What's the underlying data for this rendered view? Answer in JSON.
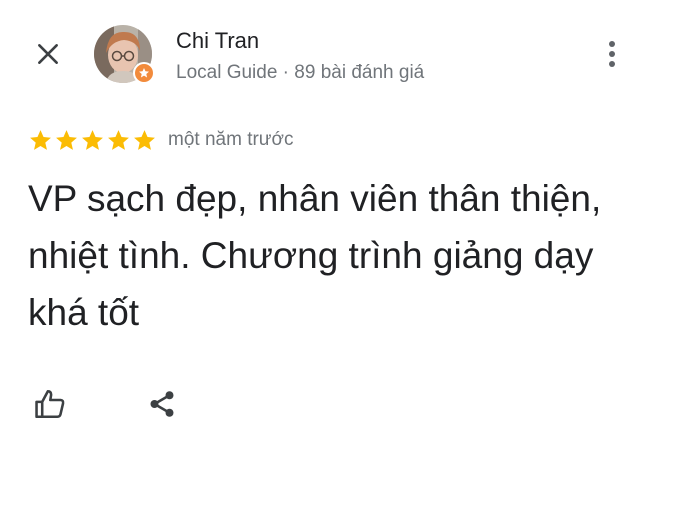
{
  "header": {
    "close_icon": "close-icon",
    "more_icon": "more-vert-icon"
  },
  "author": {
    "name": "Chi Tran",
    "meta": "Local Guide · 89 bài đánh giá",
    "avatar": "user-avatar",
    "badge_icon": "local-guide-star-badge-icon",
    "badge_color": "#f28b3c"
  },
  "review": {
    "rating": 5,
    "rating_max": 5,
    "star_color": "#fbbc04",
    "date": "một năm trước",
    "text": "VP sạch đẹp, nhân viên thân thiện, nhiệt tình. Chương trình giảng dạy khá tốt"
  },
  "actions": {
    "like_icon": "thumb-up-icon",
    "share_icon": "share-icon"
  }
}
